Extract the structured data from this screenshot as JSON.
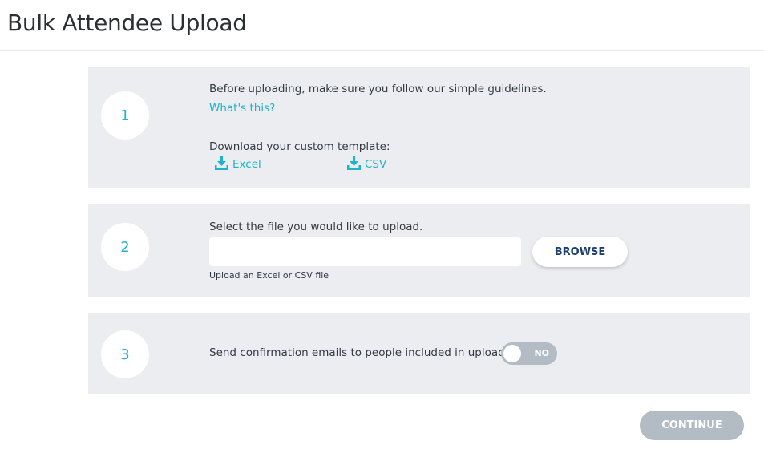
{
  "header": {
    "title": "Bulk Attendee Upload"
  },
  "steps": [
    {
      "number": "1",
      "guidelines_text": "Before uploading, make sure you follow our simple guidelines.",
      "whats_this_link": "What's this?",
      "template_label": "Download your custom template:",
      "downloads": [
        {
          "label": "Excel",
          "icon": "download-icon"
        },
        {
          "label": "CSV",
          "icon": "download-icon"
        }
      ]
    },
    {
      "number": "2",
      "select_text": "Select the file you would like to upload.",
      "file_input_value": "",
      "hint": "Upload an Excel or CSV file",
      "browse_label": "BROWSE"
    },
    {
      "number": "3",
      "confirmation_text": "Send confirmation emails to people included in upload:",
      "toggle_state": "NO"
    }
  ],
  "continue_label": "CONTINUE",
  "colors": {
    "accent": "#1fb2cb",
    "panel_bg": "#ebedf0",
    "disabled": "#b3bcc4",
    "browse_text": "#1d3f6e"
  }
}
